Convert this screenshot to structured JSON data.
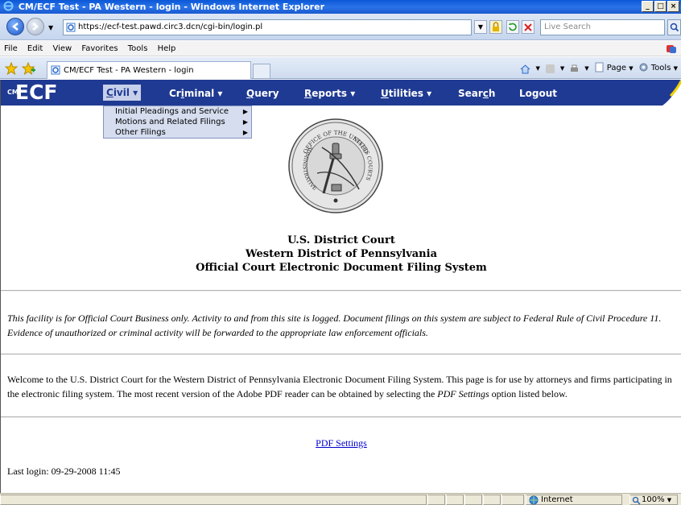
{
  "window": {
    "title": "CM/ECF Test - PA Western - login - Windows Internet Explorer",
    "buttons": [
      "_",
      "□",
      "×"
    ]
  },
  "addressbar": {
    "url": "https://ecf-test.pawd.circ3.dcn/cgi-bin/login.pl",
    "search_placeholder": "Live Search"
  },
  "menubar": [
    "File",
    "Edit",
    "View",
    "Favorites",
    "Tools",
    "Help"
  ],
  "tab": {
    "title": "CM/ECF Test - PA Western - login"
  },
  "commandbar": {
    "page": "Page",
    "tools": "Tools"
  },
  "ecf": {
    "logo": "ECF",
    "logo_prefix": "CM",
    "nav": [
      {
        "label": "Civil ▾",
        "active": true
      },
      {
        "label": "Criminal ▾"
      },
      {
        "label": "Query"
      },
      {
        "label": "Reports ▾"
      },
      {
        "label": "Utilities ▾"
      },
      {
        "label": "Search"
      },
      {
        "label": "Logout"
      }
    ],
    "civil_menu": [
      "Initial Pleadings and Service",
      "Motions and Related Filings",
      "Other Filings"
    ]
  },
  "content": {
    "heading1": "U.S. District Court",
    "heading2": "Western District of Pennsylvania",
    "heading3": "Official Court Electronic Document Filing System",
    "notice": "This facility is for Official Court Business only. Activity to and from this site is logged. Document filings on this system are subject to Federal Rule of Civil Procedure 11. Evidence of unauthorized or criminal activity will be forwarded to the appropriate law enforcement officials.",
    "welcome_prefix": "Welcome to the U.S. District Court for the Western District of Pennsylvania Electronic Document Filing System. This page is for use by attorneys and firms participating in the electronic filing system. The most recent version of the Adobe PDF reader can be obtained by selecting the ",
    "welcome_italic": "PDF Settings",
    "welcome_suffix": " option listed below.",
    "pdf_link": "PDF Settings",
    "last_login": "Last login: 09-29-2008 11:45"
  },
  "seal": {
    "text_top": "OFFICE OF THE UNITED",
    "text_left": "ADMINISTRATIVE",
    "text_right": "STATES COURTS"
  },
  "statusbar": {
    "zone": "Internet",
    "zoom": "100%"
  }
}
